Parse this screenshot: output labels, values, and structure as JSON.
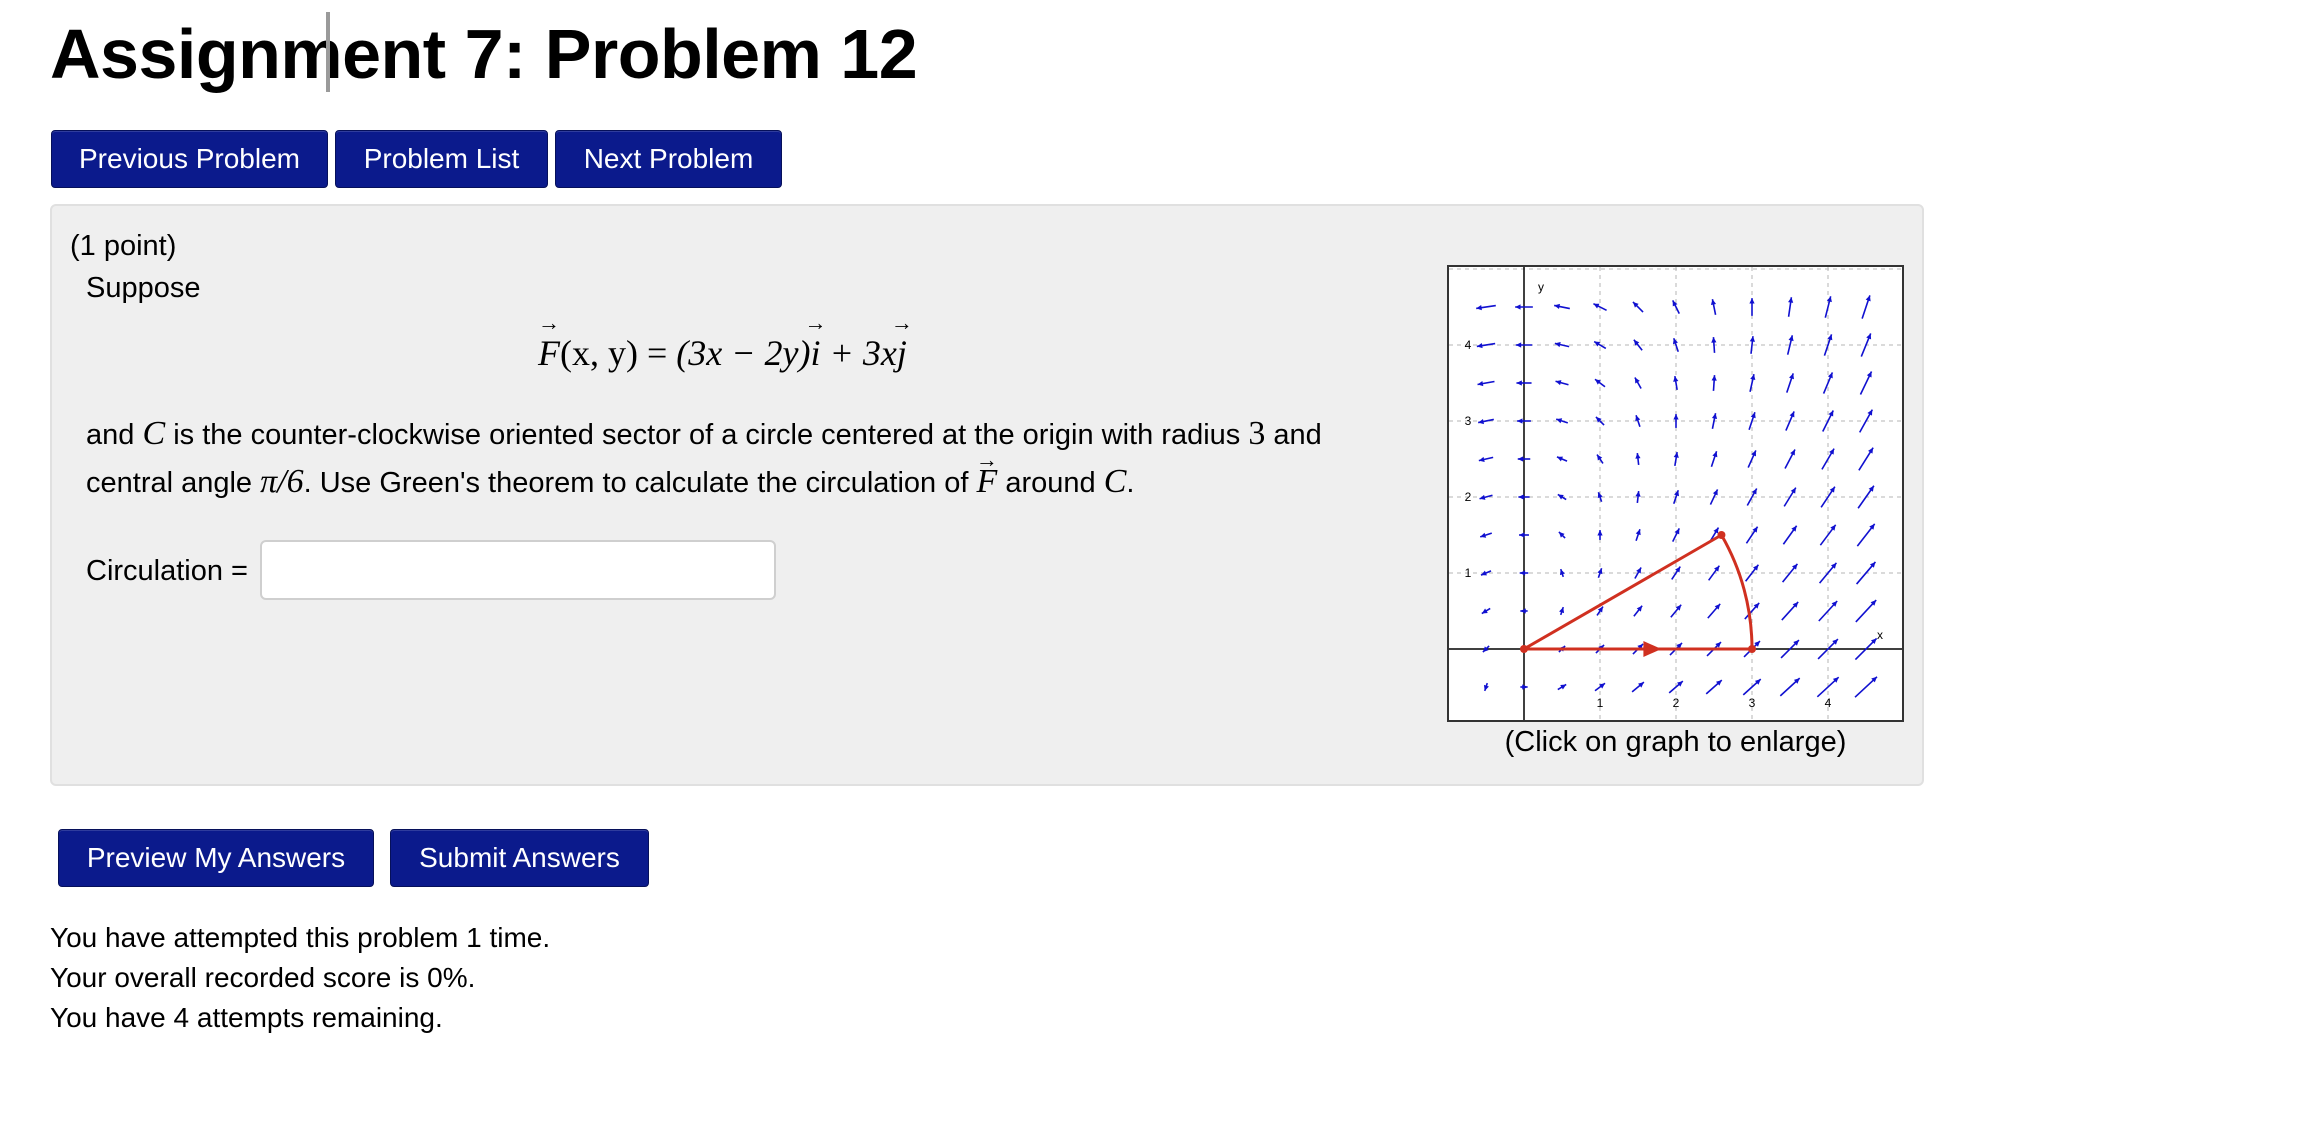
{
  "header": {
    "title": "Assignment 7: Problem 12"
  },
  "nav": {
    "previous_label": "Previous Problem",
    "list_label": "Problem List",
    "next_label": "Next Problem"
  },
  "problem": {
    "points": "(1 point)",
    "intro": "Suppose",
    "formula": {
      "F": "F",
      "args": "(x, y)",
      "equals": "=",
      "part1": "(3x − 2y)",
      "i": "i",
      "plus": "+ 3x",
      "j": "j"
    },
    "line1_a": "and",
    "line1_C": "C",
    "line1_b": "is the counter-clockwise oriented sector of a circle centered at the origin with radius",
    "line1_radius": "3",
    "line1_c": "and",
    "line2_a": "central angle",
    "line2_angle": "π/6",
    "line2_b": ". Use Green's theorem to calculate the circulation of",
    "line2_F": "F",
    "line2_c": "around",
    "line2_C": "C",
    "line2_d": ".",
    "answer_label": "Circulation =",
    "answer_value": "",
    "graph_caption": "(Click on graph to enlarge)",
    "graph": {
      "x_ticks": [
        "1",
        "2",
        "3",
        "4"
      ],
      "y_ticks": [
        "1",
        "2",
        "3",
        "4"
      ],
      "x_axis_label": "x",
      "y_axis_label": "y",
      "field_color": "#1010d0",
      "curve_color": "#d03020"
    }
  },
  "actions": {
    "preview_label": "Preview My Answers",
    "submit_label": "Submit Answers"
  },
  "status": {
    "attempts": "You have attempted this problem 1 time.",
    "score": "Your overall recorded score is 0%.",
    "remaining": "You have 4 attempts remaining."
  }
}
